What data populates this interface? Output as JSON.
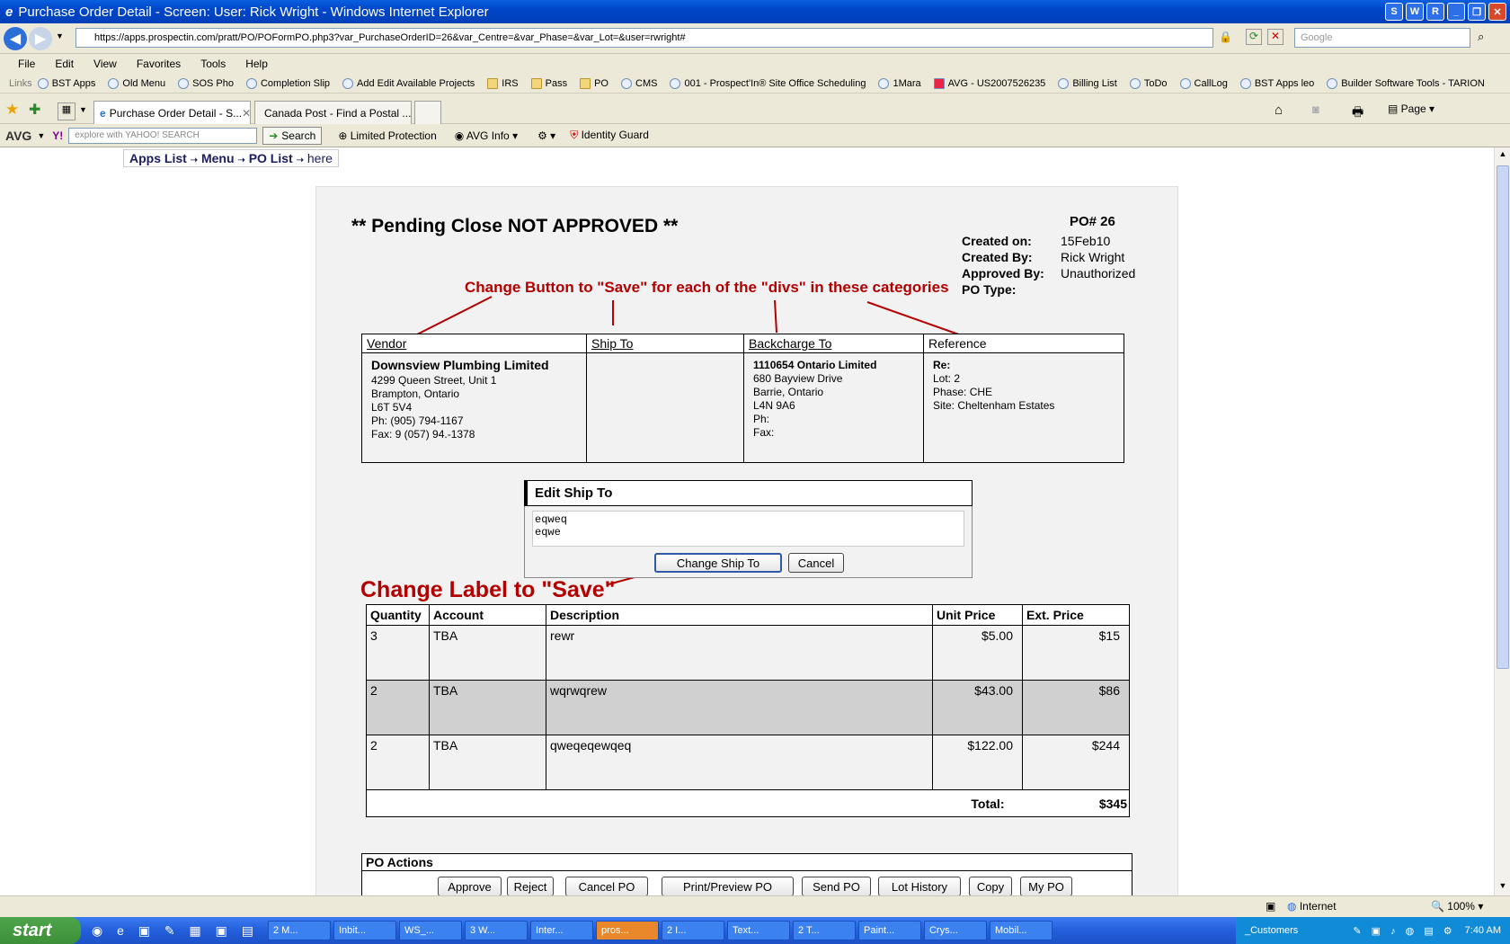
{
  "window": {
    "title": "Purchase Order Detail - Screen: User: Rick Wright - Windows Internet Explorer",
    "buttons": [
      "S",
      "W",
      "R",
      "_",
      "❐",
      "✕"
    ]
  },
  "address": {
    "url": "https://apps.prospectin.com/pratt/PO/POFormPO.php3?var_PurchaseOrderID=26&var_Centre=&var_Phase=&var_Lot=&user=rwright#",
    "search_placeholder": "Google"
  },
  "menu": [
    "File",
    "Edit",
    "View",
    "Favorites",
    "Tools",
    "Help"
  ],
  "links": {
    "label": "Links",
    "items": [
      "BST Apps",
      "Old Menu",
      "SOS Pho",
      "Completion Slip",
      "Add Edit Available Projects",
      "IRS",
      "Pass",
      "PO",
      "CMS",
      "001 - Prospect'In® Site Office Scheduling",
      "1Mara",
      "AVG - US2007526235",
      "Billing List",
      "ToDo",
      "CallLog",
      "BST Apps leo",
      "Builder Software Tools - TARION"
    ]
  },
  "tabs": [
    {
      "label": "Purchase Order Detail - S..."
    },
    {
      "label": "Canada Post - Find a Postal ..."
    }
  ],
  "cmdbar": {
    "page": "Page"
  },
  "avg": {
    "brand": "AVG",
    "yahoo_placeholder": "explore with YAHOO! SEARCH",
    "search": "Search",
    "limited": "Limited Protection",
    "info": "AVG Info",
    "identity": "Identity Guard"
  },
  "breadcrumb": {
    "apps": "Apps List",
    "menu": "Menu",
    "polist": "PO List",
    "here": "here",
    "sep": "➝"
  },
  "po": {
    "status": "** Pending Close NOT APPROVED **",
    "number": "PO# 26",
    "meta": [
      {
        "k": "Created on:",
        "v": "15Feb10"
      },
      {
        "k": "Created By:",
        "v": "Rick Wright"
      },
      {
        "k": "Approved By:",
        "v": "Unauthorized"
      },
      {
        "k": "PO Type:",
        "v": ""
      }
    ]
  },
  "annotations": {
    "top": "Change Button to \"Save\" for each of the \"divs\" in these categories",
    "label": "Change Label to \"Save\""
  },
  "sections": {
    "vendor": {
      "title": "Vendor",
      "name": "Downsview Plumbing Limited",
      "lines": [
        "4299 Queen Street, Unit 1",
        "Brampton, Ontario",
        "L6T 5V4",
        "Ph: (905) 794-1167",
        "Fax: 9 (057) 94.-1378"
      ]
    },
    "shipto": {
      "title": "Ship To"
    },
    "backcharge": {
      "title": "Backcharge To",
      "name": "1110654 Ontario Limited",
      "lines": [
        "680 Bayview Drive",
        "Barrie, Ontario",
        "L4N 9A6",
        "Ph:",
        "Fax:"
      ]
    },
    "reference": {
      "title": "Reference",
      "re": "Re:",
      "lines": [
        "Lot: 2",
        "Phase: CHE",
        "Site: Cheltenham Estates"
      ]
    }
  },
  "edit_ship": {
    "title": "Edit Ship To",
    "value": "eqweq\neqwe",
    "change_button": "Change Ship To",
    "cancel_button": "Cancel"
  },
  "lines": {
    "headers": [
      "Quantity",
      "Account",
      "Description",
      "Unit Price",
      "Ext. Price"
    ],
    "rows": [
      [
        "3",
        "TBA",
        "rewr",
        "$5.00",
        "$15"
      ],
      [
        "2",
        "TBA",
        "wqrwqrew",
        "$43.00",
        "$86"
      ],
      [
        "2",
        "TBA",
        "qweqeqewqeq",
        "$122.00",
        "$244"
      ]
    ],
    "total_label": "Total:",
    "total_value": "$345"
  },
  "actions": {
    "title": "PO Actions",
    "buttons": [
      "Approve",
      "Reject",
      "Cancel PO",
      "Print/Preview PO",
      "Send PO",
      "Lot History",
      "Copy",
      "My PO"
    ]
  },
  "status": {
    "zone": "Internet",
    "zoom": "100%"
  },
  "taskbar": {
    "start": "start",
    "tasks": [
      "2 M...",
      "Inbit...",
      "WS_...",
      "3 W...",
      "Inter...",
      "pros...",
      "2 I...",
      "Text...",
      "2 T...",
      "Paint...",
      "Crys...",
      "Mobil...",
      "_Customers"
    ],
    "time": "7:40 AM"
  },
  "colors": {
    "annotation": "#b30000",
    "titlebar": "#0046c8",
    "alt_row": "#d0d0d0"
  }
}
